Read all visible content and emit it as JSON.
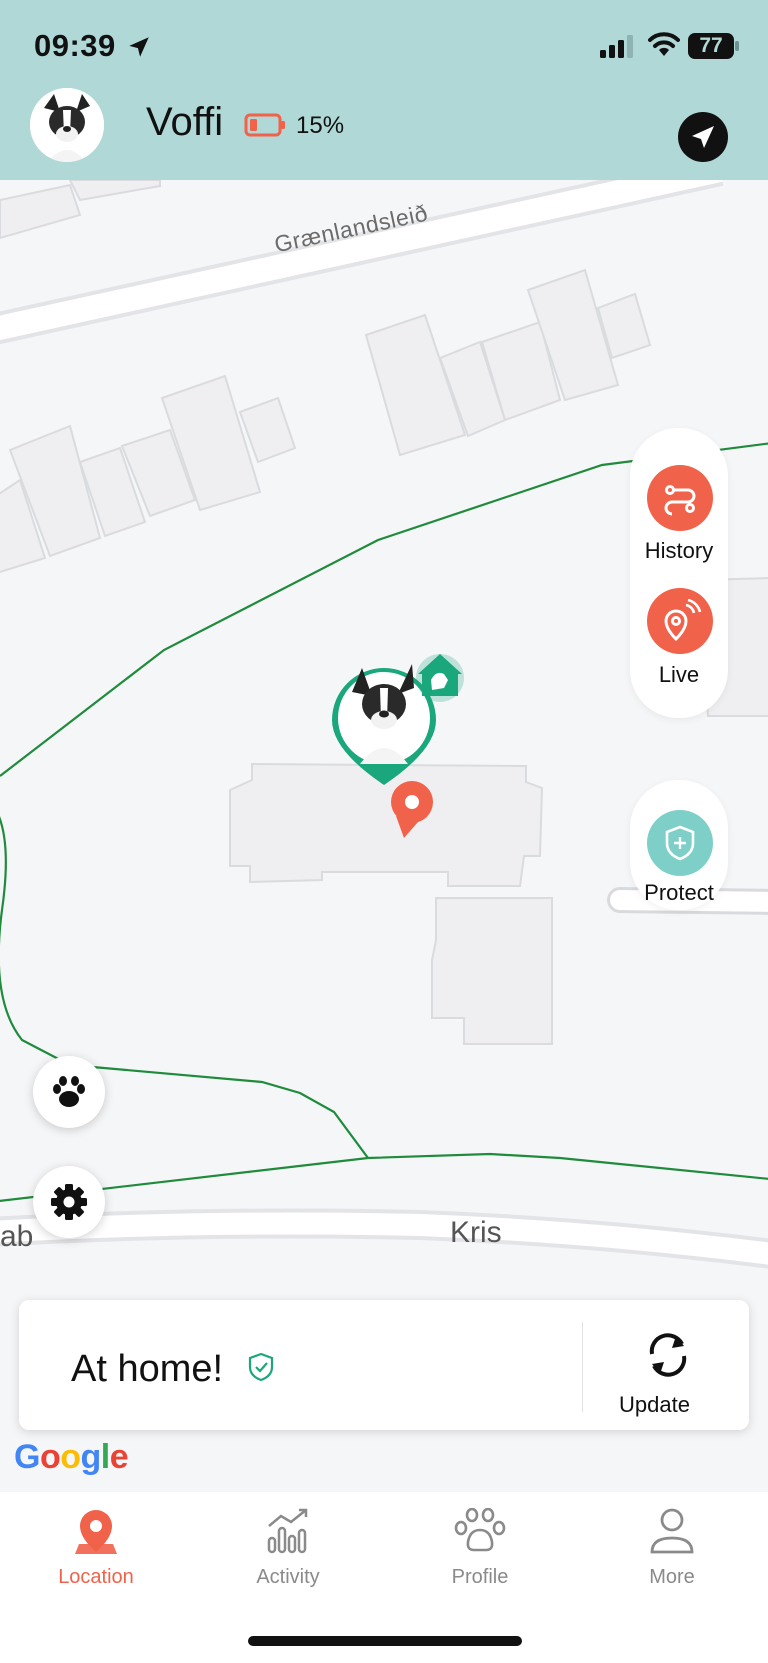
{
  "status_bar": {
    "time": "09:39",
    "battery": "77"
  },
  "header": {
    "pet_name": "Voffi",
    "battery_percent": "15%"
  },
  "map": {
    "street_top": "Grænlandsleið",
    "street_bottom_left": "ab",
    "street_bottom_right": "Kris"
  },
  "side_actions": {
    "history_label": "History",
    "live_label": "Live",
    "protect_label": "Protect"
  },
  "status_card": {
    "status_text": "At home!",
    "update_label": "Update"
  },
  "map_attribution": {
    "google": [
      "G",
      "o",
      "o",
      "g",
      "l",
      "e"
    ]
  },
  "tabs": [
    {
      "label": "Location",
      "active": true
    },
    {
      "label": "Activity",
      "active": false
    },
    {
      "label": "Profile",
      "active": false
    },
    {
      "label": "More",
      "active": false
    }
  ],
  "colors": {
    "accent": "#f1624a",
    "teal": "#1aa77c",
    "header_bg": "#b0d8d7",
    "protect": "#7fcfc9",
    "fence_line": "#1f8b3b"
  }
}
